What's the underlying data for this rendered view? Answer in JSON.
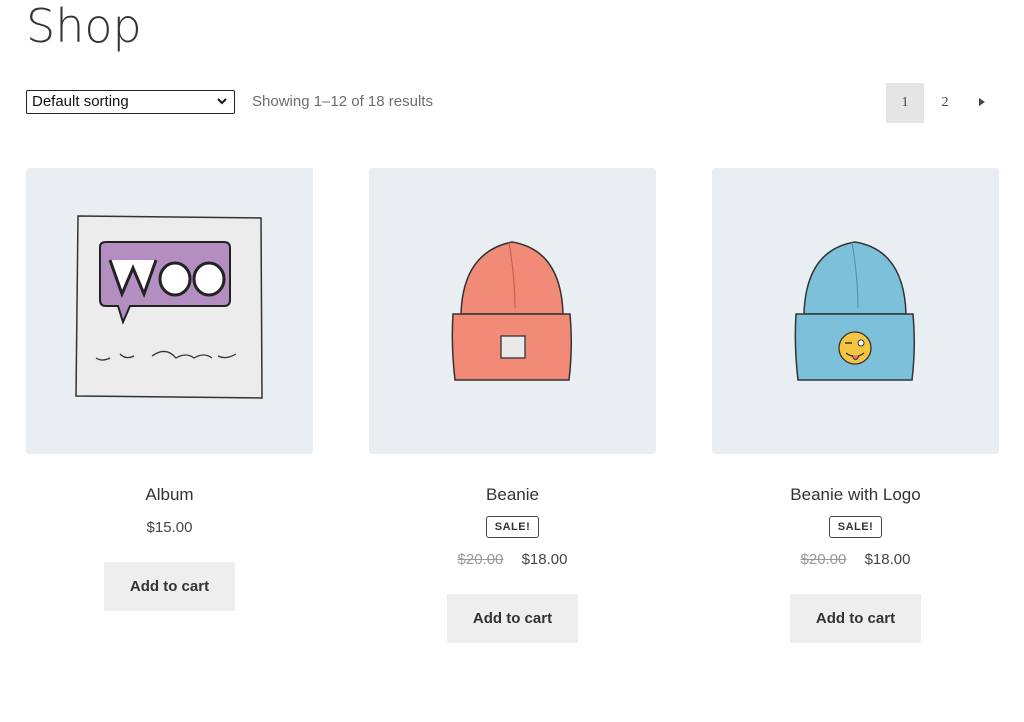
{
  "page": {
    "title": "Shop"
  },
  "toolbar": {
    "sorting": {
      "selected": "Default sorting"
    },
    "result_count": "Showing 1–12 of 18 results",
    "pagination": {
      "pages": [
        "1",
        "2"
      ],
      "current": "1",
      "next_icon": "triangle-right-icon"
    }
  },
  "products": [
    {
      "title": "Album",
      "price": "$15.00",
      "old_price": "",
      "sale": "",
      "button": "Add to cart",
      "image": "album-cover"
    },
    {
      "title": "Beanie",
      "price": "$18.00",
      "old_price": "$20.00",
      "sale": "SALE!",
      "button": "Add to cart",
      "image": "orange-beanie"
    },
    {
      "title": "Beanie with Logo",
      "price": "$18.00",
      "old_price": "$20.00",
      "sale": "SALE!",
      "button": "Add to cart",
      "image": "blue-beanie-with-logo"
    }
  ],
  "colors": {
    "thumb_bg": "#e8eef2",
    "button_bg": "#eeeeee",
    "page_current_bg": "#e5e5e5",
    "album_purple": "#b48ec1",
    "beanie_orange": "#f18a77",
    "beanie_blue": "#7cc0da"
  }
}
